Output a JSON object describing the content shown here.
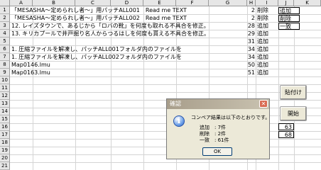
{
  "columns": [
    "A",
    "B",
    "C",
    "D",
    "E",
    "F",
    "G",
    "H",
    "I",
    "J",
    "K"
  ],
  "rows": [
    "1",
    "2",
    "3",
    "4",
    "5",
    "6",
    "7",
    "8",
    "9",
    "10",
    "11",
    "12",
    "13",
    "14",
    "15",
    "16",
    "17",
    "18",
    "19",
    "20",
    "21"
  ],
  "cells": {
    "a1": "「MESASHA～定められし者～」用パッチALL001　Read me TEXT",
    "a2": "「MESASHA～定められし者～」用パッチALL002　Read me TEXT",
    "a3": "12. レイズタウンで、あるじから「ロバの靴」を何度も取れる不具合を修正。",
    "a4": "13. キリカプールで井戸掘り名人からつるはしを何度も貰える不具合を修正。",
    "a6": "1. 圧縮ファイルを解凍し、パッチALL001フォルダ内のファイルを",
    "a7": "1. 圧縮ファイルを解凍し、パッチALL002フォルダ内のファイルを",
    "a8": "Map0146.lmu",
    "a9": "Map0163.lmu",
    "h1": "2",
    "h2": "2",
    "h3": "28",
    "h4": "29",
    "h5": "31",
    "h6": "34",
    "h7": "34",
    "h8": "50",
    "h9": "51",
    "i1": "削除",
    "i2": "削除",
    "i3": "追加",
    "i4": "追加",
    "i5": "追加",
    "i6": "追加",
    "i7": "追加",
    "i8": "追加",
    "i9": "追加",
    "j1": "追加",
    "j2": "削除",
    "j3": "一致",
    "j16": "63",
    "j17": "68"
  },
  "buttons": {
    "paste": "貼付け",
    "start": "開始"
  },
  "dialog": {
    "title": "確認",
    "close": "✕",
    "message": "コンペア結果は以下のとおりです。",
    "line1": "追加　: 7件",
    "line2": "削除　: 2件",
    "line3": "一致　: 61件",
    "ok": "OK",
    "icon": "i"
  }
}
